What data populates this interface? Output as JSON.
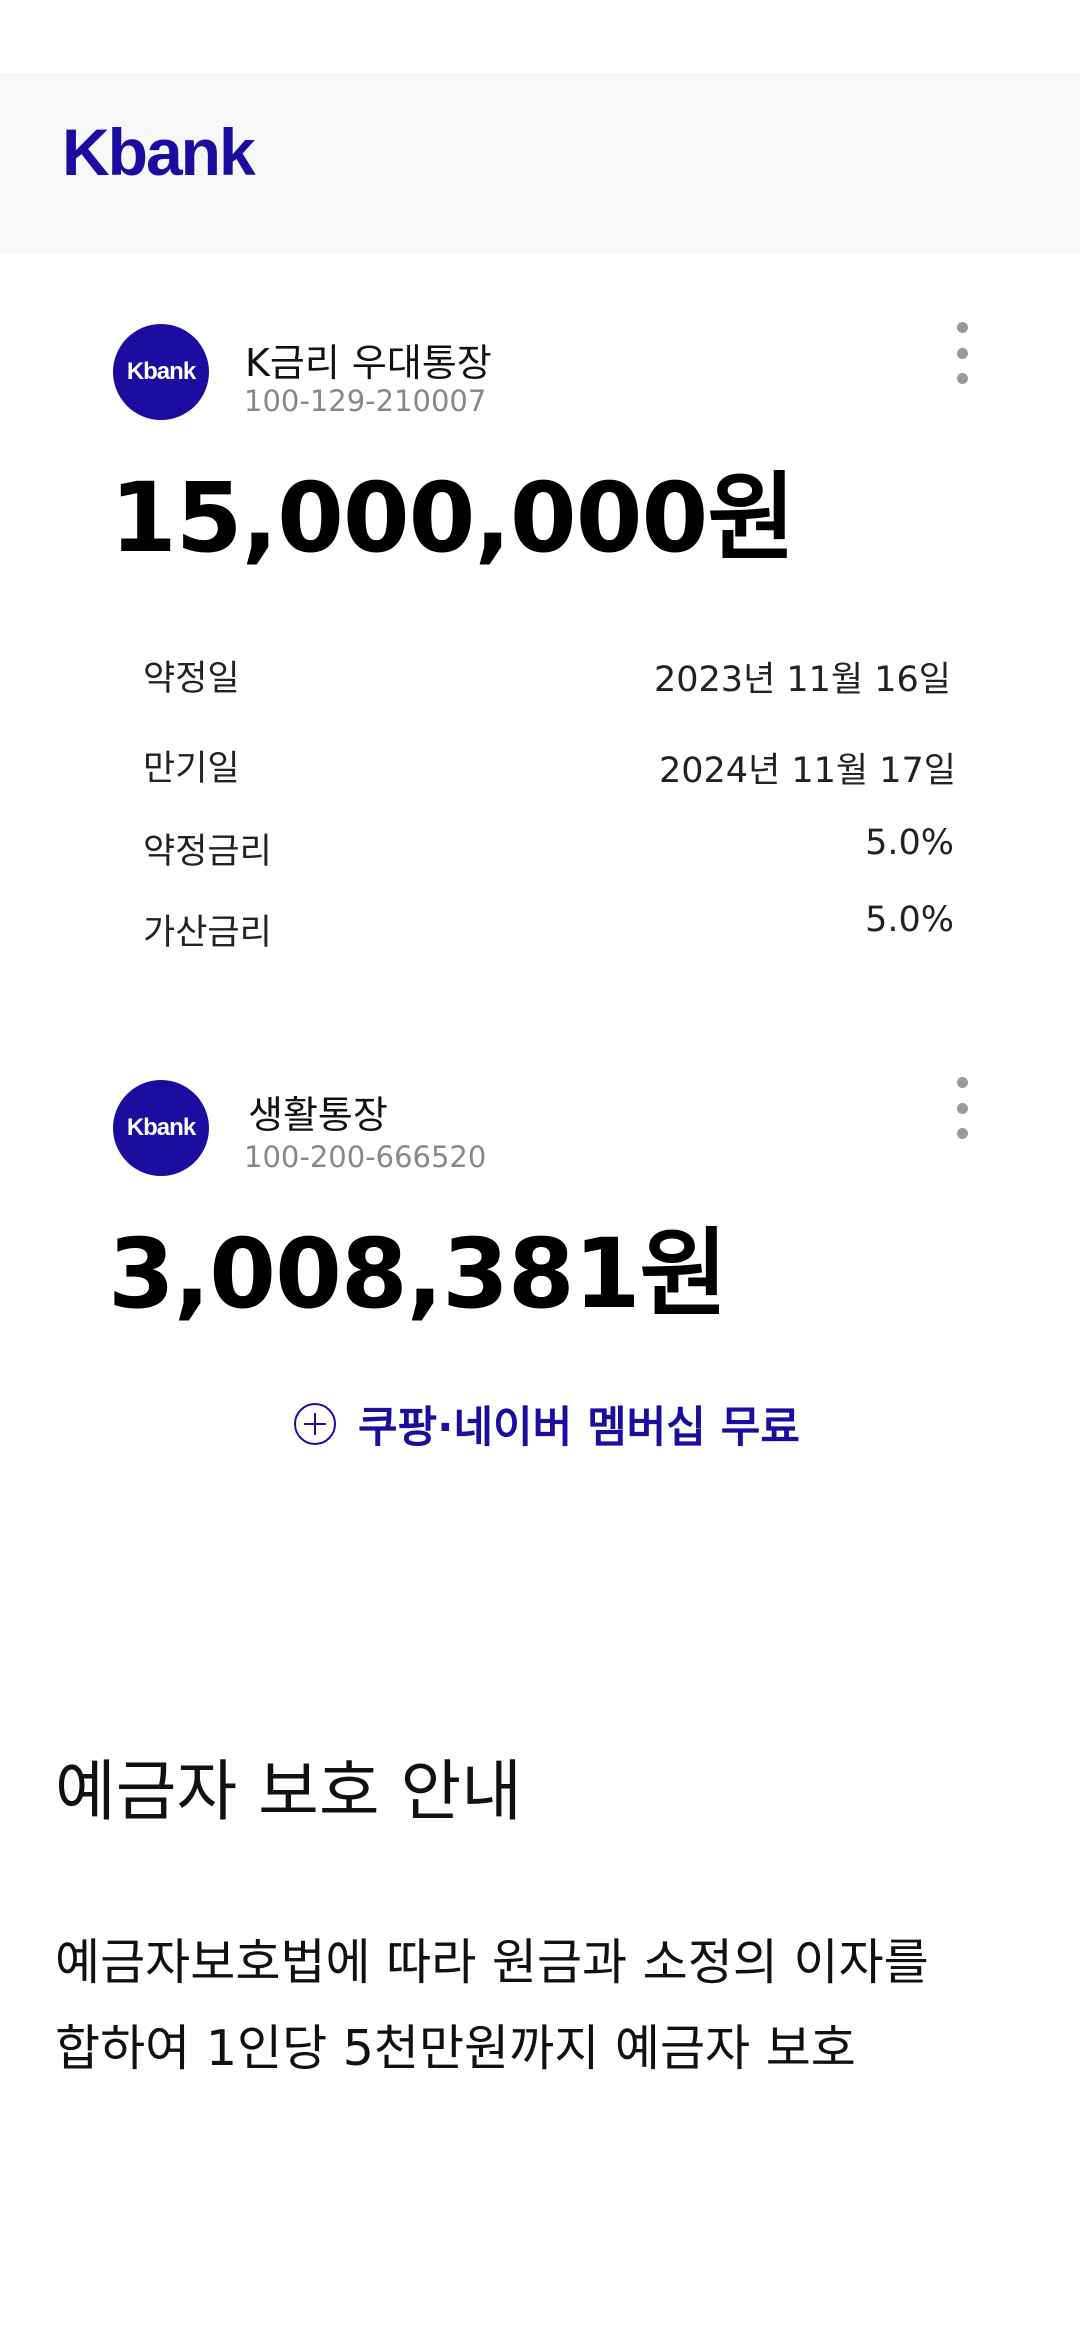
{
  "header": {
    "logo": "Kbank"
  },
  "accounts": [
    {
      "avatar_label": "Kbank",
      "name": "K금리 우대통장",
      "number": "100-129-210007",
      "balance": "15,000,000원",
      "details": [
        {
          "label": "약정일",
          "value": "2023년 11월 16일"
        },
        {
          "label": "만기일",
          "value": "2024년 11월 17일"
        },
        {
          "label": "약정금리",
          "value": "5.0%"
        },
        {
          "label": "가산금리",
          "value": "5.0%"
        }
      ]
    },
    {
      "avatar_label": "Kbank",
      "name": "생활통장",
      "number": "100-200-666520",
      "balance": "3,008,381원"
    }
  ],
  "promo": {
    "label": "쿠팡·네이버 멤버십 무료"
  },
  "notice": {
    "title": "예금자 보호 안내",
    "body_line1": "예금자보호법에 따라 원금과 소정의 이자를",
    "body_line2": "합하여 1인당 5천만원까지 예금자 보호"
  },
  "colors": {
    "brand": "#1d0ca0",
    "header_bg": "#f7f7f7",
    "muted_text": "#888888"
  }
}
